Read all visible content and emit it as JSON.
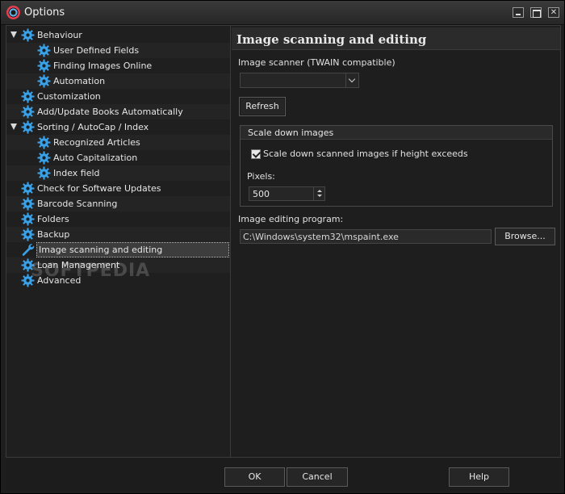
{
  "window": {
    "title": "Options"
  },
  "tree": {
    "items": [
      {
        "label": "Behaviour",
        "level": 0,
        "expanded": true
      },
      {
        "label": "User Defined Fields",
        "level": 1
      },
      {
        "label": "Finding Images Online",
        "level": 1
      },
      {
        "label": "Automation",
        "level": 1
      },
      {
        "label": "Customization",
        "level": 0
      },
      {
        "label": "Add/Update Books Automatically",
        "level": 0
      },
      {
        "label": "Sorting / AutoCap / Index",
        "level": 0,
        "expanded": true
      },
      {
        "label": "Recognized Articles",
        "level": 1
      },
      {
        "label": "Auto Capitalization",
        "level": 1
      },
      {
        "label": "Index field",
        "level": 1
      },
      {
        "label": "Check for Software Updates",
        "level": 0
      },
      {
        "label": "Barcode Scanning",
        "level": 0
      },
      {
        "label": "Folders",
        "level": 0
      },
      {
        "label": "Backup",
        "level": 0
      },
      {
        "label": "Image scanning and editing",
        "level": 0,
        "selected": true
      },
      {
        "label": "Loan Management",
        "level": 0
      },
      {
        "label": "Advanced",
        "level": 0
      }
    ],
    "watermark": "SOFTPEDIA"
  },
  "panel": {
    "title": "Image scanning and editing",
    "scanner_label": "Image scanner (TWAIN compatible)",
    "scanner_value": "",
    "refresh_label": "Refresh",
    "group_title": "Scale down images",
    "checkbox_label": "Scale down scanned images if height exceeds",
    "checkbox_checked": true,
    "pixels_label": "Pixels:",
    "pixels_value": "500",
    "editor_label": "Image editing program:",
    "editor_path": "C:\\Windows\\system32\\mspaint.exe",
    "browse_label": "Browse..."
  },
  "footer": {
    "ok_label": "OK",
    "cancel_label": "Cancel",
    "help_label": "Help"
  },
  "colors": {
    "gear_blue": "#3aa0e8",
    "background": "#1e1e1e",
    "selection": "#3d3d3d"
  }
}
